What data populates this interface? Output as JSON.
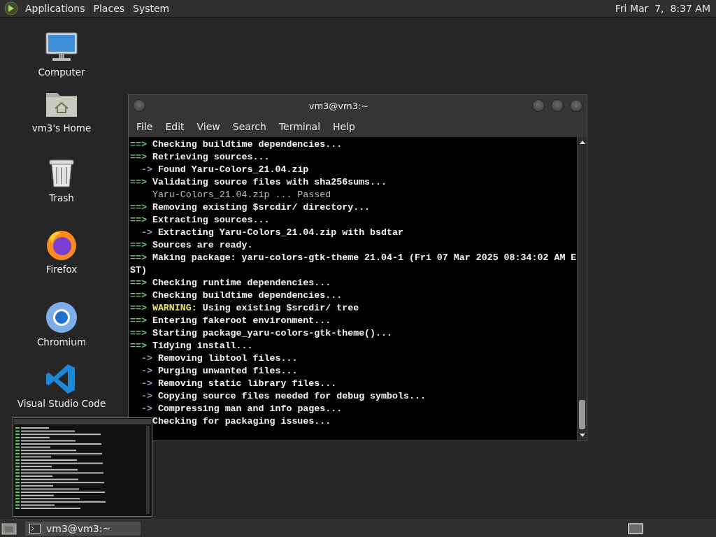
{
  "top_panel": {
    "menus": [
      "Applications",
      "Places",
      "System"
    ],
    "clock": "Fri Mar  7,  8:37 AM"
  },
  "desktop_icons": [
    {
      "label": "Computer",
      "kind": "computer"
    },
    {
      "label": "vm3's Home",
      "kind": "home"
    },
    {
      "label": "Trash",
      "kind": "trash"
    },
    {
      "label": "Firefox",
      "kind": "firefox"
    },
    {
      "label": "Chromium",
      "kind": "chromium"
    },
    {
      "label": "Visual Studio Code",
      "kind": "vscode"
    }
  ],
  "terminal_window": {
    "title": "vm3@vm3:~",
    "menu": [
      "File",
      "Edit",
      "View",
      "Search",
      "Terminal",
      "Help"
    ],
    "lines": [
      {
        "kind": "step",
        "prefix": "==>",
        "text": "Checking buildtime dependencies..."
      },
      {
        "kind": "step",
        "prefix": "==>",
        "text": "Retrieving sources..."
      },
      {
        "kind": "sub",
        "prefix": "->",
        "text": "Found Yaru-Colors_21.04.zip"
      },
      {
        "kind": "step",
        "prefix": "==>",
        "text": "Validating source files with sha256sums..."
      },
      {
        "kind": "plain",
        "text": "Yaru-Colors_21.04.zip ... Passed"
      },
      {
        "kind": "step",
        "prefix": "==>",
        "text": "Removing existing $srcdir/ directory..."
      },
      {
        "kind": "step",
        "prefix": "==>",
        "text": "Extracting sources..."
      },
      {
        "kind": "sub",
        "prefix": "->",
        "text": "Extracting Yaru-Colors_21.04.zip with bsdtar"
      },
      {
        "kind": "step",
        "prefix": "==>",
        "text": "Sources are ready."
      },
      {
        "kind": "step",
        "prefix": "==>",
        "text": "Making package: yaru-colors-gtk-theme 21.04-1 (Fri 07 Mar 2025 08:34:02 AM E"
      },
      {
        "kind": "wrap",
        "text": "ST)"
      },
      {
        "kind": "step",
        "prefix": "==>",
        "text": "Checking runtime dependencies..."
      },
      {
        "kind": "step",
        "prefix": "==>",
        "text": "Checking buildtime dependencies..."
      },
      {
        "kind": "warning",
        "prefix": "==>",
        "label": "WARNING:",
        "text": "Using existing $srcdir/ tree"
      },
      {
        "kind": "step",
        "prefix": "==>",
        "text": "Entering fakeroot environment..."
      },
      {
        "kind": "step",
        "prefix": "==>",
        "text": "Starting package_yaru-colors-gtk-theme()..."
      },
      {
        "kind": "step",
        "prefix": "==>",
        "text": "Tidying install..."
      },
      {
        "kind": "sub",
        "prefix": "->",
        "text": "Removing libtool files..."
      },
      {
        "kind": "sub",
        "prefix": "->",
        "text": "Purging unwanted files..."
      },
      {
        "kind": "sub",
        "prefix": "->",
        "text": "Removing static library files..."
      },
      {
        "kind": "sub",
        "prefix": "->",
        "text": "Copying source files needed for debug symbols..."
      },
      {
        "kind": "sub",
        "prefix": "->",
        "text": "Compressing man and info pages..."
      },
      {
        "kind": "covered",
        "text": "Checking for packaging issues..."
      }
    ]
  },
  "taskbar": {
    "tasks": [
      {
        "label": "vm3@vm3:~",
        "selected": true
      }
    ]
  }
}
